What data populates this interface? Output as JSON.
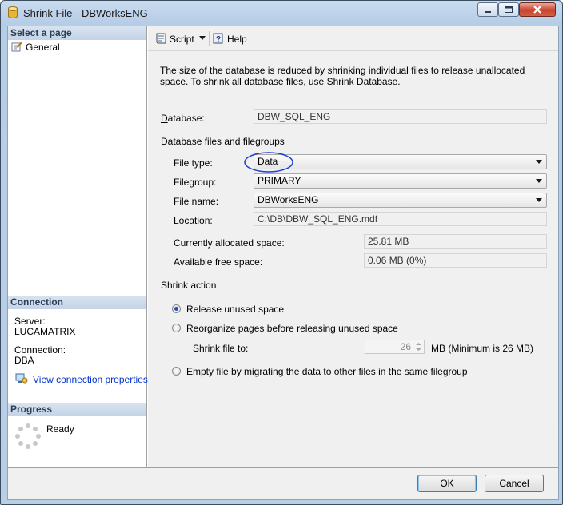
{
  "window": {
    "title": "Shrink File - DBWorksENG"
  },
  "left_pane": {
    "select_page_header": "Select a page",
    "pages": [
      {
        "label": "General"
      }
    ],
    "connection_header": "Connection",
    "server_label": "Server:",
    "server_value": "LUCAMATRIX",
    "connection_label": "Connection:",
    "connection_value": "DBA",
    "view_connection_link": "View connection properties",
    "progress_header": "Progress",
    "progress_status": "Ready"
  },
  "toolbar": {
    "script_label": "Script",
    "help_label": "Help"
  },
  "main": {
    "description": "The size of the database is reduced by shrinking individual files to release unallocated space. To shrink all database files, use Shrink Database.",
    "database_label": "Database:",
    "database_value": "DBW_SQL_ENG",
    "files_group_label": "Database files and filegroups",
    "file_type_label": "File type:",
    "file_type_value": "Data",
    "filegroup_label": "Filegroup:",
    "filegroup_value": "PRIMARY",
    "file_name_label": "File name:",
    "file_name_value": "DBWorksENG",
    "location_label": "Location:",
    "location_value": "C:\\DB\\DBW_SQL_ENG.mdf",
    "allocated_label": "Currently allocated space:",
    "allocated_value": "25.81 MB",
    "free_label": "Available free space:",
    "free_value": "0.06 MB (0%)",
    "shrink_action_label": "Shrink action",
    "options": [
      {
        "label": "Release unused space",
        "selected": true
      },
      {
        "label": "Reorganize pages before releasing unused space",
        "selected": false
      },
      {
        "label": "Empty file by migrating the data to other files in the same filegroup",
        "selected": false
      }
    ],
    "shrink_file_to_label": "Shrink file to:",
    "shrink_file_to_value": "26",
    "shrink_unit_note": "MB (Minimum is 26 MB)"
  },
  "buttons": {
    "ok": "OK",
    "cancel": "Cancel"
  },
  "colors": {
    "highlight_ellipse": "#1f3fd0",
    "link": "#0033cc"
  }
}
